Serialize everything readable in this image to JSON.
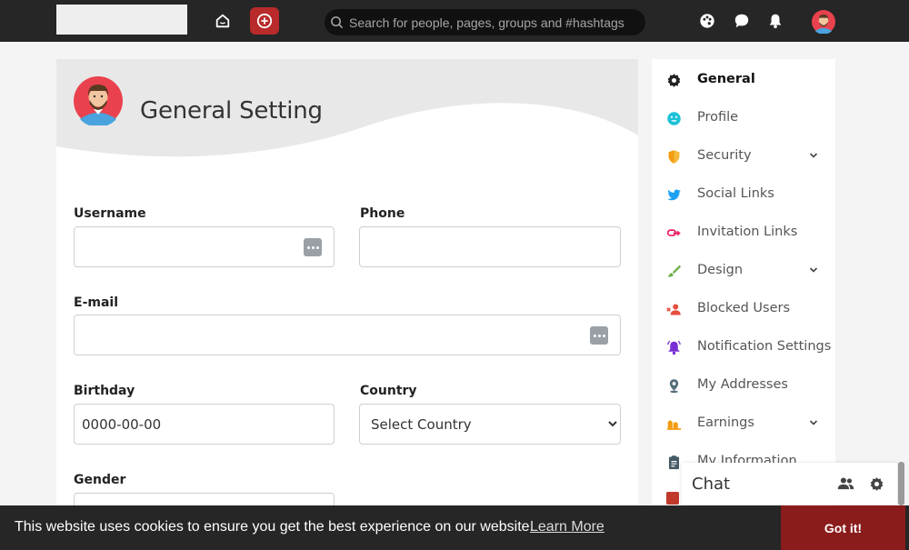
{
  "topbar": {
    "search_placeholder": "Search for people, pages, groups and #hashtags",
    "icons": [
      "home-icon",
      "plus-circle-icon",
      "search-icon",
      "palette-icon",
      "chat-bubble-icon",
      "bell-icon",
      "avatar"
    ]
  },
  "page": {
    "title": "General Setting"
  },
  "form": {
    "username_label": "Username",
    "phone_label": "Phone",
    "email_label": "E-mail",
    "birthday_label": "Birthday",
    "birthday_value": "0000-00-00",
    "country_label": "Country",
    "country_value": "Select Country",
    "gender_label": "Gender"
  },
  "sidebar": {
    "items": [
      {
        "label": "General",
        "icon": "gear-icon"
      },
      {
        "label": "Profile",
        "icon": "smile-face-icon"
      },
      {
        "label": "Security",
        "icon": "shield-icon"
      },
      {
        "label": "Social Links",
        "icon": "twitter-icon"
      },
      {
        "label": "Invitation Links",
        "icon": "link-icon"
      },
      {
        "label": "Design",
        "icon": "brush-icon"
      },
      {
        "label": "Blocked Users",
        "icon": "block-user-icon"
      },
      {
        "label": "Notification Settings",
        "icon": "bell-icon"
      },
      {
        "label": "My Addresses",
        "icon": "map-pin-icon"
      },
      {
        "label": "Earnings",
        "icon": "money-icon"
      },
      {
        "label": "My Information",
        "icon": "clipboard-icon"
      }
    ]
  },
  "chat": {
    "title": "Chat"
  },
  "cookie": {
    "text": "This website uses cookies to ensure you get the best experience on our website.",
    "link": "Learn More",
    "button": "Got it!"
  },
  "colors": {
    "topbar": "#262626",
    "accent": "#b92a2a",
    "cookie_button": "#8b1c1c"
  }
}
